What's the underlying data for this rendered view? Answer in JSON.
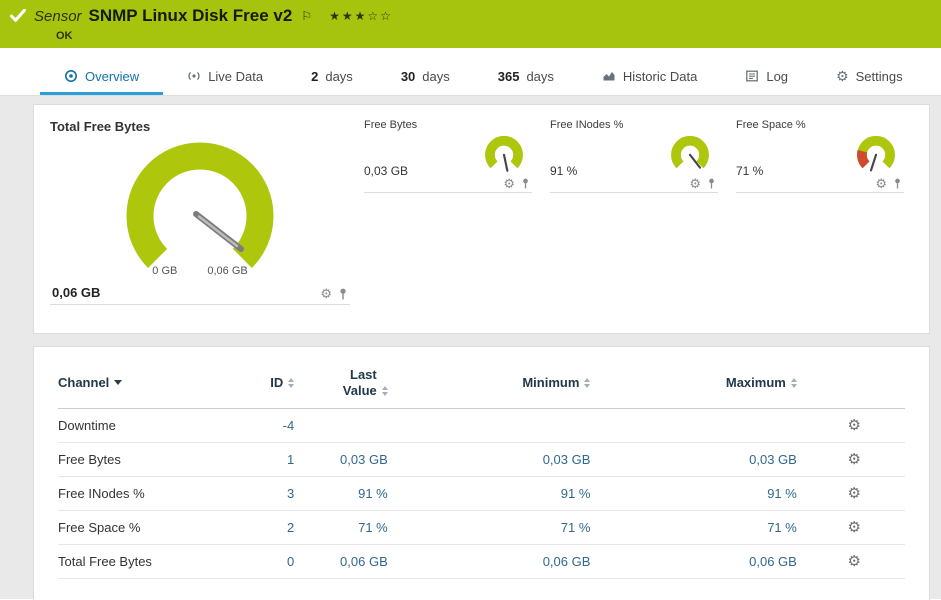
{
  "icons": {
    "flag": "⚐",
    "gear": "⚙"
  },
  "header": {
    "kind": "Sensor",
    "title": "SNMP Linux Disk Free v2",
    "status": "OK",
    "priority_stars": "★★★☆☆"
  },
  "tabs": [
    {
      "label": "Overview"
    },
    {
      "label": "Live Data"
    },
    {
      "number": "2",
      "label": "days"
    },
    {
      "number": "30",
      "label": "days"
    },
    {
      "number": "365",
      "label": "days"
    },
    {
      "label": "Historic Data"
    },
    {
      "label": "Log"
    },
    {
      "label": "Settings"
    }
  ],
  "gauges": {
    "main": {
      "title": "Total Free Bytes",
      "value": "0,06 GB",
      "scale_min": "0 GB",
      "scale_max": "0,06 GB"
    },
    "mini": [
      {
        "title": "Free Bytes",
        "value": "0,03 GB"
      },
      {
        "title": "Free INodes %",
        "value": "91 %"
      },
      {
        "title": "Free Space %",
        "value": "71 %"
      }
    ]
  },
  "table": {
    "headers": {
      "channel": "Channel",
      "id": "ID",
      "last": "Last Value",
      "min": "Minimum",
      "max": "Maximum"
    },
    "rows": [
      {
        "channel": "Downtime",
        "id": "-4",
        "last": "",
        "min": "",
        "max": ""
      },
      {
        "channel": "Free Bytes",
        "id": "1",
        "last": "0,03 GB",
        "min": "0,03 GB",
        "max": "0,03 GB"
      },
      {
        "channel": "Free INodes %",
        "id": "3",
        "last": "91 %",
        "min": "91 %",
        "max": "91 %"
      },
      {
        "channel": "Free Space %",
        "id": "2",
        "last": "71 %",
        "min": "71 %",
        "max": "71 %"
      },
      {
        "channel": "Total Free Bytes",
        "id": "0",
        "last": "0,06 GB",
        "min": "0,06 GB",
        "max": "0,06 GB"
      }
    ]
  },
  "colors": {
    "brand_green": "#a6c40e",
    "gauge_green": "#aec60b",
    "gauge_red": "#cf4a2e",
    "active_tab_blue": "#1273a8",
    "tab_underline": "#2b9fd9",
    "value_blue": "#31688f"
  }
}
